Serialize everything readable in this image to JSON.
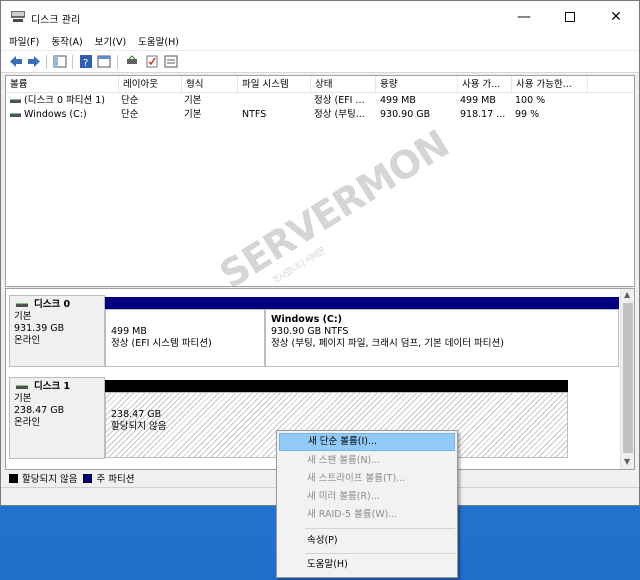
{
  "window": {
    "title": "디스크 관리"
  },
  "menubar": [
    "파일(F)",
    "동작(A)",
    "보기(V)",
    "도움말(H)"
  ],
  "volume_table": {
    "columns": [
      "볼륨",
      "레이아웃",
      "형식",
      "파일 시스템",
      "상태",
      "용량",
      "사용 가...",
      "사용 가능한..."
    ],
    "rows": [
      [
        "(디스크 0 파티션 1)",
        "단순",
        "기본",
        "",
        "정상 (EFI ...",
        "499 MB",
        "499 MB",
        "100 %"
      ],
      [
        "Windows (C:)",
        "단순",
        "기본",
        "NTFS",
        "정상 (부팅...",
        "930.90 GB",
        "918.17 ...",
        "99 %"
      ]
    ]
  },
  "disks": [
    {
      "name": "디스크 0",
      "type": "기본",
      "size": "931.39 GB",
      "status": "온라인",
      "partitions": [
        {
          "title": "",
          "line1": "499 MB",
          "line2": "정상 (EFI 시스템 파티션)"
        },
        {
          "title": "Windows  (C:)",
          "line1": "930.90 GB NTFS",
          "line2": "정상 (부팅, 페이지 파일, 크래시 덤프, 기본 데이터 파티션)"
        }
      ]
    },
    {
      "name": "디스크 1",
      "type": "기본",
      "size": "238.47 GB",
      "status": "온라인",
      "partitions": [
        {
          "title": "",
          "line1": "238.47 GB",
          "line2": "할당되지 않음"
        }
      ]
    }
  ],
  "legend": [
    {
      "label": "할당되지 않음",
      "color": "#000000"
    },
    {
      "label": "주 파티션",
      "color": "#000080"
    }
  ],
  "context_menu": {
    "items": [
      {
        "label": "새 단순 볼륨(I)...",
        "enabled": true
      },
      {
        "label": "새 스팬 볼륨(N)...",
        "enabled": false
      },
      {
        "label": "새 스트라이프 볼륨(T)...",
        "enabled": false
      },
      {
        "label": "새 미러 볼륨(R)...",
        "enabled": false
      },
      {
        "label": "새 RAID-5 볼륨(W)...",
        "enabled": false
      },
      {
        "label": "속성(P)",
        "enabled": true
      },
      {
        "label": "도움말(H)",
        "enabled": true
      }
    ]
  },
  "watermark": {
    "brand": "SERVERMON",
    "sub": "조사합니다 서버몬"
  },
  "colors": {
    "partition_bar": "#000080",
    "unallocated_bar": "#000000",
    "highlight": "#91c9f7",
    "accent_green": "#7cc47c"
  }
}
